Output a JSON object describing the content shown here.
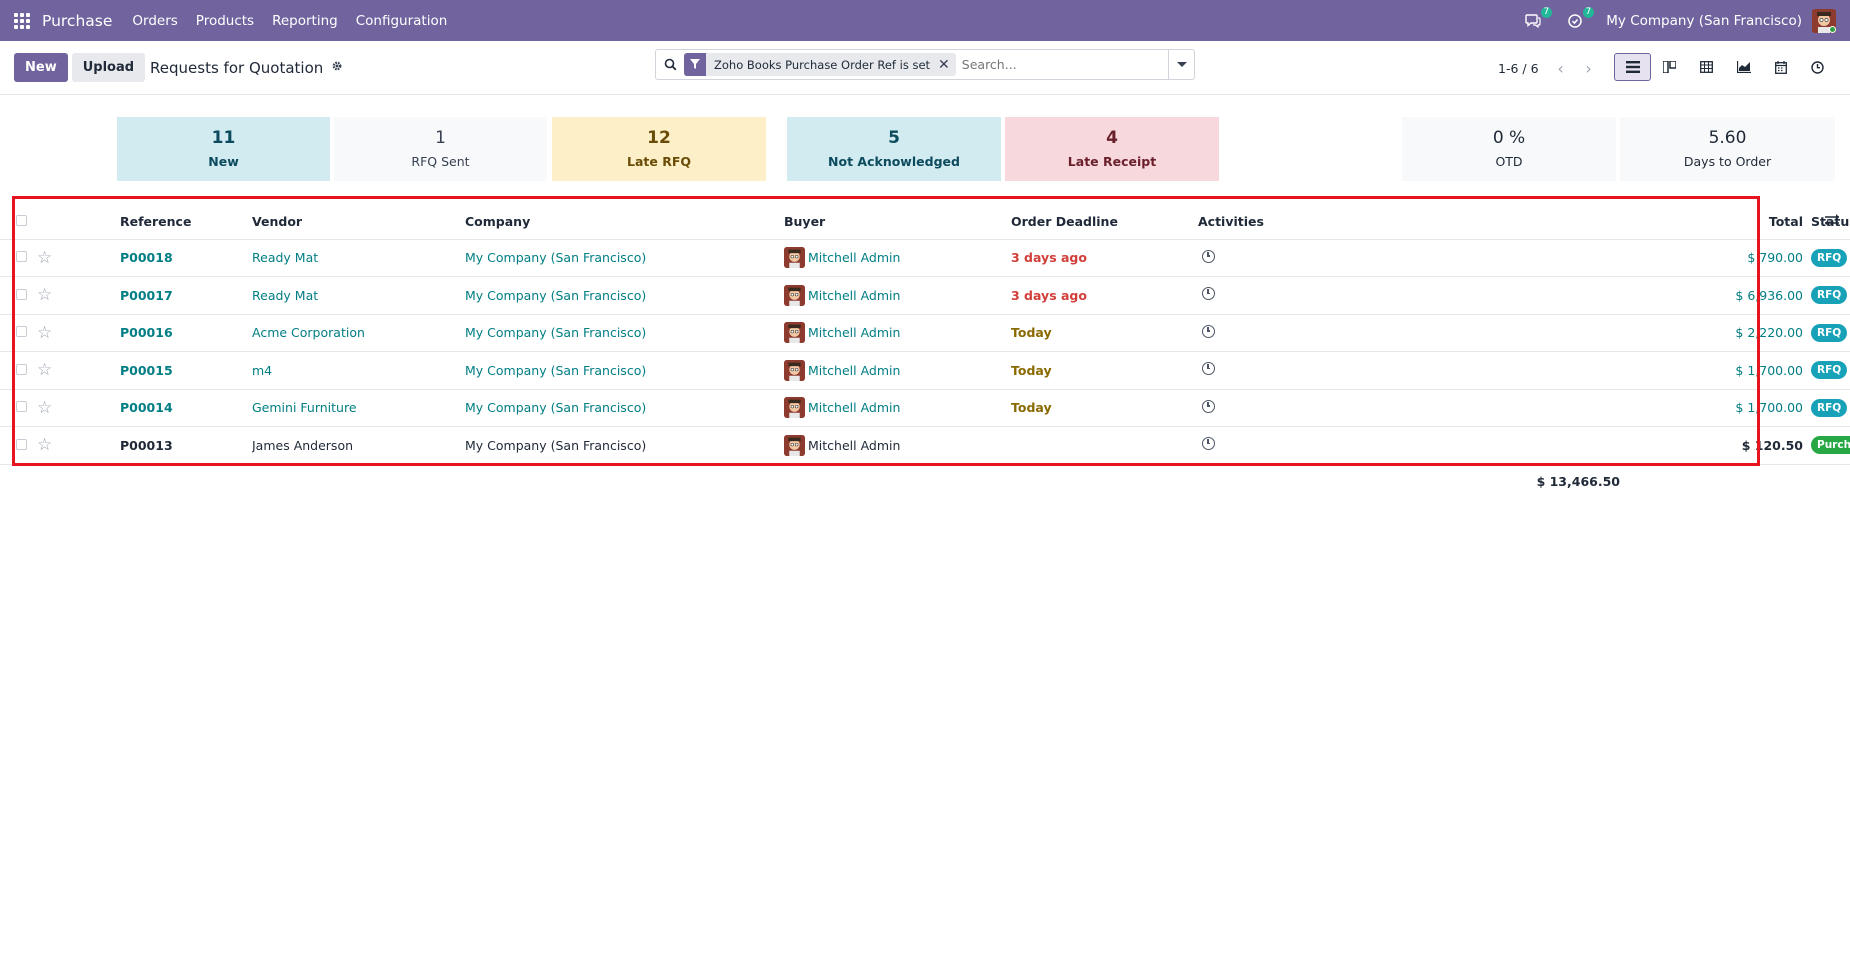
{
  "navbar": {
    "brand": "Purchase",
    "menu": [
      "Orders",
      "Products",
      "Reporting",
      "Configuration"
    ],
    "messages_count": "7",
    "activities_count": "7",
    "company": "My Company (San Francisco)"
  },
  "control": {
    "new_label": "New",
    "upload_label": "Upload",
    "title": "Requests for Quotation",
    "facet_label": "Zoho Books Purchase Order Ref is set",
    "search_placeholder": "Search...",
    "pager": "1-6 / 6"
  },
  "cards": [
    {
      "value": "11",
      "label": "New",
      "bg": "#d2ebf1",
      "color": "#0c4a5e"
    },
    {
      "value": "1",
      "label": "RFQ Sent",
      "bg": "#f8f9fa",
      "color": "#374151"
    },
    {
      "value": "12",
      "label": "Late RFQ",
      "bg": "#fdefc8",
      "color": "#6a4c06"
    },
    {
      "value": "5",
      "label": "Not Acknowledged",
      "bg": "#d2ebf1",
      "color": "#0c4a5e"
    },
    {
      "value": "4",
      "label": "Late Receipt",
      "bg": "#f7d8dc",
      "color": "#6b1f2a"
    },
    {
      "value": "0 %",
      "label": "OTD",
      "bg": "#f8f9fa",
      "color": "#1f2937"
    },
    {
      "value": "5.60",
      "label": "Days to Order",
      "bg": "#f8f9fa",
      "color": "#1f2937"
    }
  ],
  "table": {
    "headers": {
      "reference": "Reference",
      "vendor": "Vendor",
      "company": "Company",
      "buyer": "Buyer",
      "deadline": "Order Deadline",
      "activities": "Activities",
      "total": "Total",
      "status": "Status"
    },
    "rows": [
      {
        "ref": "P00018",
        "vendor": "Ready Mat",
        "company": "My Company (San Francisco)",
        "buyer": "Mitchell Admin",
        "deadline": "3 days ago",
        "total": "$ 790.00",
        "status": "RFQ"
      },
      {
        "ref": "P00017",
        "vendor": "Ready Mat",
        "company": "My Company (San Francisco)",
        "buyer": "Mitchell Admin",
        "deadline": "3 days ago",
        "total": "$ 6,936.00",
        "status": "RFQ"
      },
      {
        "ref": "P00016",
        "vendor": "Acme Corporation",
        "company": "My Company (San Francisco)",
        "buyer": "Mitchell Admin",
        "deadline": "Today",
        "total": "$ 2,220.00",
        "status": "RFQ"
      },
      {
        "ref": "P00015",
        "vendor": "m4",
        "company": "My Company (San Francisco)",
        "buyer": "Mitchell Admin",
        "deadline": "Today",
        "total": "$ 1,700.00",
        "status": "RFQ"
      },
      {
        "ref": "P00014",
        "vendor": "Gemini Furniture",
        "company": "My Company (San Francisco)",
        "buyer": "Mitchell Admin",
        "deadline": "Today",
        "total": "$ 1,700.00",
        "status": "RFQ"
      },
      {
        "ref": "P00013",
        "vendor": "James Anderson",
        "company": "My Company (San Francisco)",
        "buyer": "Mitchell Admin",
        "deadline": "",
        "total": "$ 120.50",
        "status": "Purchase Order"
      }
    ],
    "sum_total": "$ 13,466.50"
  },
  "colors": {
    "navbar": "#71639e",
    "link": "#017e84",
    "overdue": "#d23f3a",
    "today": "#8a6a00",
    "rfq_badge": "#17a2b8",
    "po_badge": "#28a745",
    "highlight": "#e5141e"
  },
  "icons": {
    "apps": "apps-grid-icon",
    "messages": "chat-icon",
    "activities": "clock-check-icon",
    "search": "search-icon",
    "filter": "filter-icon",
    "settings": "gear-icon",
    "activity": "clock-icon",
    "favorite": "star-icon",
    "optional_columns": "sliders-icon"
  }
}
